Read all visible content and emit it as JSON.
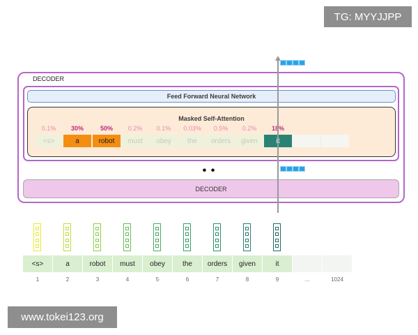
{
  "watermarks": {
    "top": "TG: MYYJJPP",
    "bottom": "www.tokei123.org"
  },
  "decoder": {
    "title": "DECODER",
    "ffnn_label": "Feed Forward Neural Network",
    "msa_title": "Masked Self-Attention",
    "ellipsis": "• • •",
    "lower_label": "DECODER"
  },
  "attention": {
    "percentages": [
      "0.1%",
      "30%",
      "50%",
      "0.2%",
      "0.1%",
      "0.03%",
      "0.5%",
      "0.2%",
      "18%"
    ],
    "tokens": [
      "<s>",
      "a",
      "robot",
      "must",
      "obey",
      "the",
      "orders",
      "given",
      "it"
    ]
  },
  "input_tokens": [
    "<s>",
    "a",
    "robot",
    "must",
    "obey",
    "the",
    "orders",
    "given",
    "it",
    "",
    ""
  ],
  "positions": [
    "1",
    "2",
    "3",
    "4",
    "5",
    "6",
    "7",
    "8",
    "9",
    "...",
    "1024"
  ],
  "colors": {
    "frame": "#b566c8",
    "highlight": "#f48e13",
    "current": "#2a8275",
    "vector_gradient": [
      "#e7e931",
      "#bedc3f",
      "#8fcd4c",
      "#66bd58",
      "#48ac62",
      "#36a067",
      "#2c916c",
      "#267e6e",
      "#236b68"
    ]
  }
}
